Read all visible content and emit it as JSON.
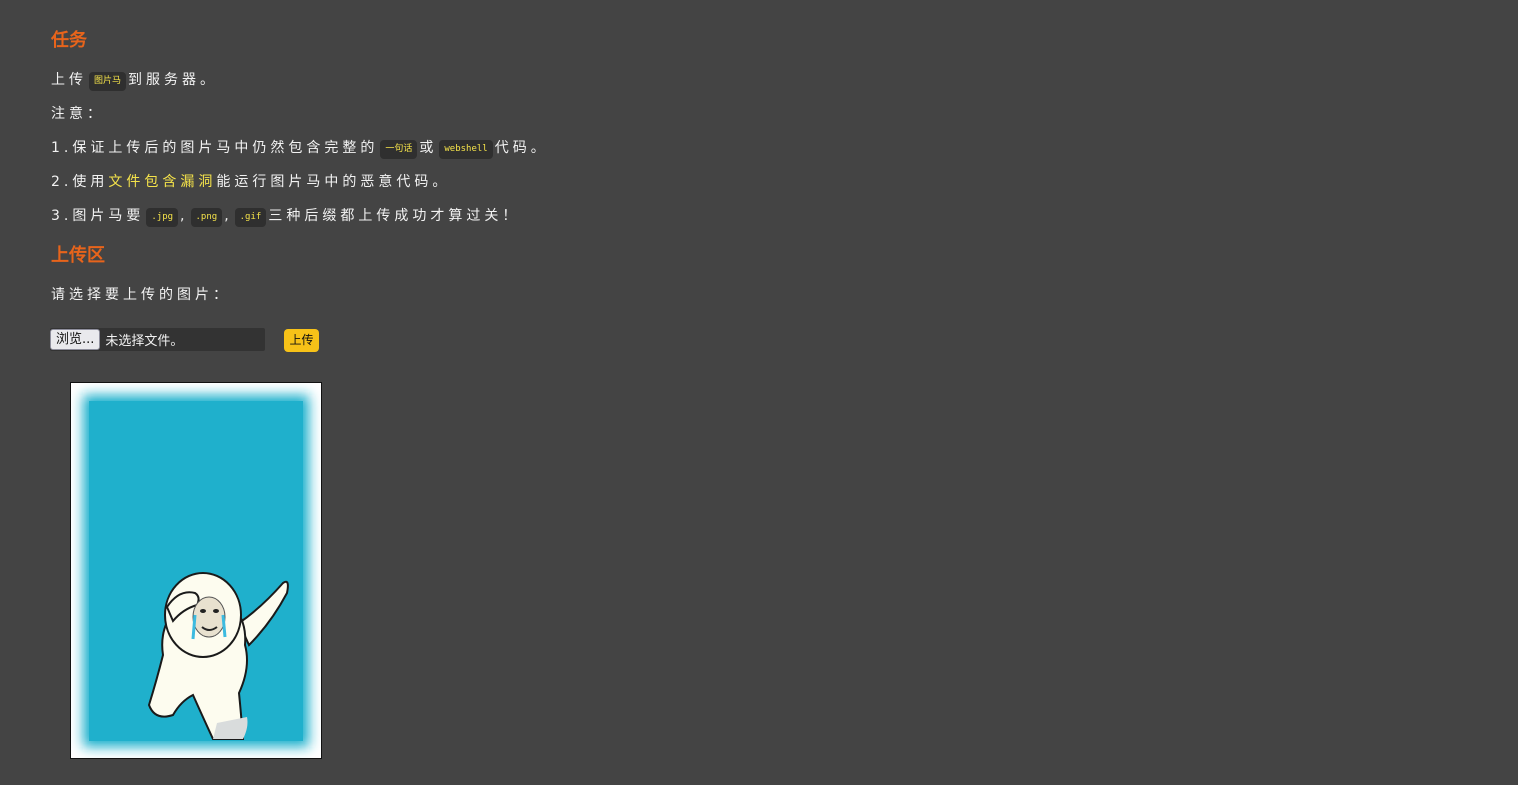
{
  "task": {
    "title": "任务",
    "line1_pre": "上传",
    "line1_code": "图片马",
    "line1_post": "到服务器。",
    "note_label": "注意：",
    "item1_pre": "1.保证上传后的图片马中仍然包含完整的",
    "item1_code1": "一句话",
    "item1_mid": "或",
    "item1_code2": "webshell",
    "item1_post": "代码。",
    "item2_pre": "2.使用",
    "item2_highlight": "文件包含漏洞",
    "item2_post": "能运行图片马中的恶意代码。",
    "item3_pre": "3.图片马要",
    "ext_jpg": ".jpg",
    "sep1": ",",
    "ext_png": ".png",
    "sep2": ",",
    "ext_gif": ".gif",
    "item3_post": "三种后缀都上传成功才算过关！"
  },
  "upload": {
    "title": "上传区",
    "prompt": "请选择要上传的图片：",
    "browse_label": "浏览...",
    "file_status": "未选择文件。",
    "submit_label": "上传"
  },
  "preview": {
    "image_name": "dancing-meme-character-image"
  },
  "colors": {
    "background": "#444444",
    "heading": "#e8641b",
    "code_text": "#f5e34a",
    "upload_button": "#f7c218",
    "preview_sky": "#1fb0cc"
  }
}
